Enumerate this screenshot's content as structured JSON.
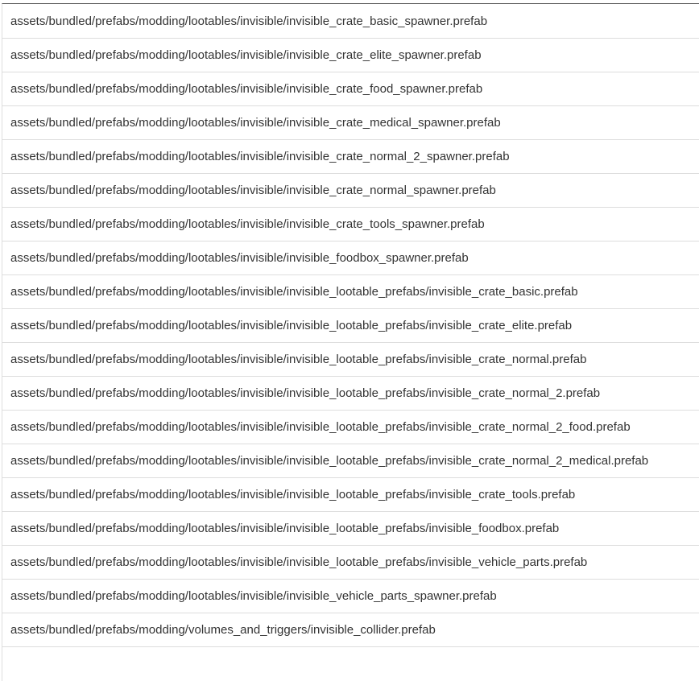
{
  "file_list": {
    "rows": [
      "assets/bundled/prefabs/modding/lootables/invisible/invisible_crate_basic_spawner.prefab",
      "assets/bundled/prefabs/modding/lootables/invisible/invisible_crate_elite_spawner.prefab",
      "assets/bundled/prefabs/modding/lootables/invisible/invisible_crate_food_spawner.prefab",
      "assets/bundled/prefabs/modding/lootables/invisible/invisible_crate_medical_spawner.prefab",
      "assets/bundled/prefabs/modding/lootables/invisible/invisible_crate_normal_2_spawner.prefab",
      "assets/bundled/prefabs/modding/lootables/invisible/invisible_crate_normal_spawner.prefab",
      "assets/bundled/prefabs/modding/lootables/invisible/invisible_crate_tools_spawner.prefab",
      "assets/bundled/prefabs/modding/lootables/invisible/invisible_foodbox_spawner.prefab",
      "assets/bundled/prefabs/modding/lootables/invisible/invisible_lootable_prefabs/invisible_crate_basic.prefab",
      "assets/bundled/prefabs/modding/lootables/invisible/invisible_lootable_prefabs/invisible_crate_elite.prefab",
      "assets/bundled/prefabs/modding/lootables/invisible/invisible_lootable_prefabs/invisible_crate_normal.prefab",
      "assets/bundled/prefabs/modding/lootables/invisible/invisible_lootable_prefabs/invisible_crate_normal_2.prefab",
      "assets/bundled/prefabs/modding/lootables/invisible/invisible_lootable_prefabs/invisible_crate_normal_2_food.prefab",
      "assets/bundled/prefabs/modding/lootables/invisible/invisible_lootable_prefabs/invisible_crate_normal_2_medical.prefab",
      "assets/bundled/prefabs/modding/lootables/invisible/invisible_lootable_prefabs/invisible_crate_tools.prefab",
      "assets/bundled/prefabs/modding/lootables/invisible/invisible_lootable_prefabs/invisible_foodbox.prefab",
      "assets/bundled/prefabs/modding/lootables/invisible/invisible_lootable_prefabs/invisible_vehicle_parts.prefab",
      "assets/bundled/prefabs/modding/lootables/invisible/invisible_vehicle_parts_spawner.prefab",
      "assets/bundled/prefabs/modding/volumes_and_triggers/invisible_collider.prefab",
      ""
    ]
  }
}
